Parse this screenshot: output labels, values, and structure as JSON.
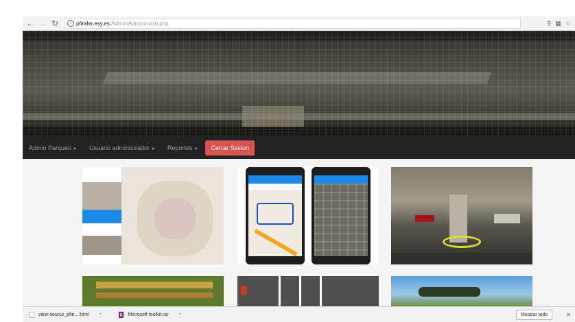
{
  "browser": {
    "url_host": "pfinder.esy.es",
    "url_path": "/Admin/Admin/inicio.php"
  },
  "navbar": {
    "items": [
      {
        "label": "Admin Parqueo"
      },
      {
        "label": "Usuario administrador"
      },
      {
        "label": "Reportes"
      }
    ],
    "logout_label": "Cerrar Sesion"
  },
  "downloads": {
    "items": [
      {
        "label": "view-source_pfin....html"
      },
      {
        "label": "Microsoft toolkit.rar"
      }
    ],
    "show_all_label": "Mostrar todo"
  },
  "colors": {
    "navbar_bg": "#222222",
    "logout_bg": "#d9534f"
  }
}
